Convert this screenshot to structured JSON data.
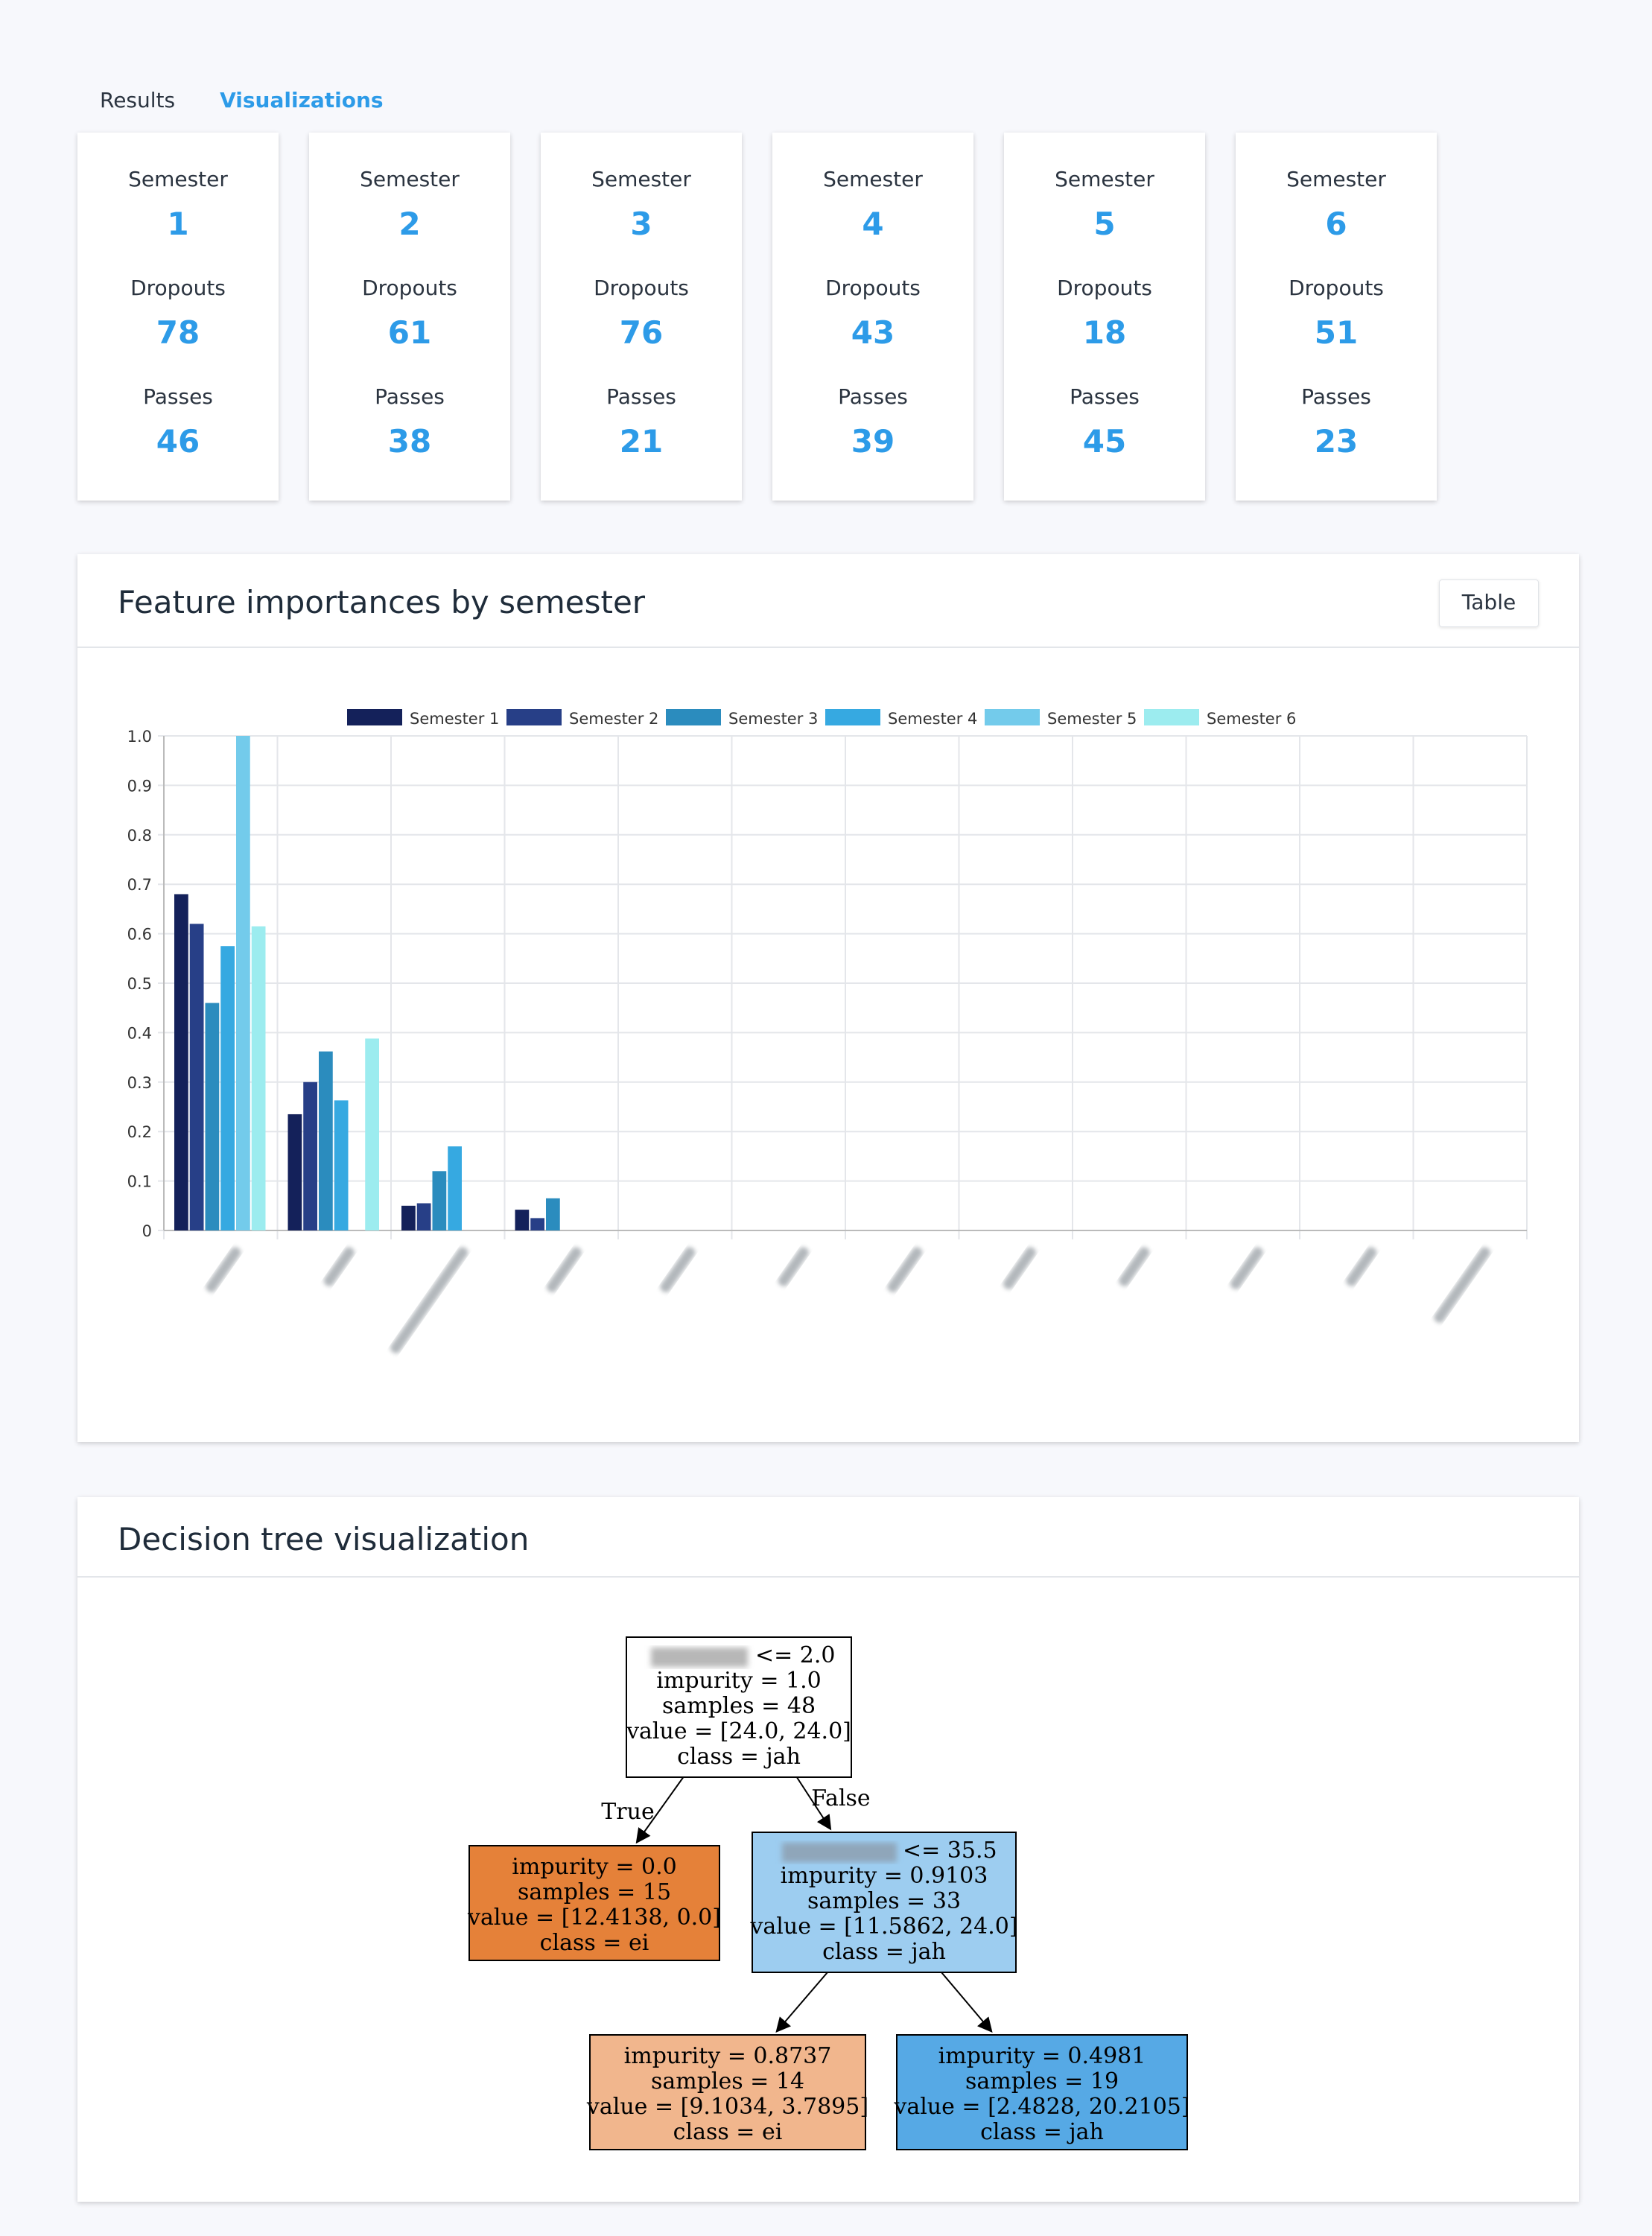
{
  "tabs": [
    {
      "label": "Results",
      "active": false
    },
    {
      "label": "Visualizations",
      "active": true
    }
  ],
  "stat_cards": [
    {
      "semester_label": "Semester",
      "semester": "1",
      "dropouts_label": "Dropouts",
      "dropouts": "78",
      "passes_label": "Passes",
      "passes": "46"
    },
    {
      "semester_label": "Semester",
      "semester": "2",
      "dropouts_label": "Dropouts",
      "dropouts": "61",
      "passes_label": "Passes",
      "passes": "38"
    },
    {
      "semester_label": "Semester",
      "semester": "3",
      "dropouts_label": "Dropouts",
      "dropouts": "76",
      "passes_label": "Passes",
      "passes": "21"
    },
    {
      "semester_label": "Semester",
      "semester": "4",
      "dropouts_label": "Dropouts",
      "dropouts": "43",
      "passes_label": "Passes",
      "passes": "39"
    },
    {
      "semester_label": "Semester",
      "semester": "5",
      "dropouts_label": "Dropouts",
      "dropouts": "18",
      "passes_label": "Passes",
      "passes": "45"
    },
    {
      "semester_label": "Semester",
      "semester": "6",
      "dropouts_label": "Dropouts",
      "dropouts": "51",
      "passes_label": "Passes",
      "passes": "23"
    }
  ],
  "feature_panel": {
    "title": "Feature importances by semester",
    "table_button": "Table"
  },
  "tree_panel": {
    "title": "Decision tree visualization"
  },
  "colors": {
    "accent": "#2d9be8",
    "series": [
      "#14215a",
      "#273f87",
      "#2b8cbe",
      "#36a9e1",
      "#73cbeb",
      "#9cecef"
    ],
    "node_orange": "#e58139",
    "node_light_orange": "#f1b68d",
    "node_light_blue": "#9dcdf0",
    "node_blue": "#56a9e5"
  },
  "chart_data": {
    "type": "bar",
    "title": "",
    "xlabel": "",
    "ylabel": "",
    "ylim": [
      0,
      1.0
    ],
    "yticks": [
      "0",
      "0.1",
      "0.2",
      "0.3",
      "0.4",
      "0.5",
      "0.6",
      "0.7",
      "0.8",
      "0.9",
      "1.0"
    ],
    "grid": true,
    "legend_position": "top-center",
    "categories_blurred": true,
    "categories": [
      "",
      "",
      "",
      "",
      "",
      "",
      "",
      "",
      "",
      "",
      "",
      ""
    ],
    "series": [
      {
        "name": "Semester 1",
        "values": [
          0.68,
          0.235,
          0.05,
          0.042,
          0,
          0,
          0,
          0,
          0,
          0,
          0,
          0
        ]
      },
      {
        "name": "Semester 2",
        "values": [
          0.62,
          0.3,
          0.055,
          0.025,
          0,
          0,
          0,
          0,
          0,
          0,
          0,
          0
        ]
      },
      {
        "name": "Semester 3",
        "values": [
          0.46,
          0.362,
          0.12,
          0.065,
          0,
          0,
          0,
          0,
          0,
          0,
          0,
          0
        ]
      },
      {
        "name": "Semester 4",
        "values": [
          0.575,
          0.263,
          0.17,
          0,
          0,
          0,
          0,
          0,
          0,
          0,
          0,
          0
        ]
      },
      {
        "name": "Semester 5",
        "values": [
          1.0,
          0,
          0,
          0,
          0,
          0,
          0,
          0,
          0,
          0,
          0,
          0
        ]
      },
      {
        "name": "Semester 6",
        "values": [
          0.615,
          0.388,
          0,
          0,
          0,
          0,
          0,
          0,
          0,
          0,
          0,
          0
        ]
      }
    ]
  },
  "tree": {
    "root": {
      "split_op": "<= 2.0",
      "impurity": "impurity = 1.0",
      "samples": "samples = 48",
      "value": "value = [24.0, 24.0]",
      "class": "class = jah"
    },
    "left_edge_label": "True",
    "right_edge_label": "False",
    "left_leaf": {
      "impurity": "impurity = 0.0",
      "samples": "samples = 15",
      "value": "value = [12.4138, 0.0]",
      "class": "class = ei"
    },
    "right_node": {
      "split_op": "<= 35.5",
      "impurity": "impurity = 0.9103",
      "samples": "samples = 33",
      "value": "value = [11.5862, 24.0]",
      "class": "class = jah"
    },
    "right_left_leaf": {
      "impurity": "impurity = 0.8737",
      "samples": "samples = 14",
      "value": "value = [9.1034, 3.7895]",
      "class": "class = ei"
    },
    "right_right_leaf": {
      "impurity": "impurity = 0.4981",
      "samples": "samples = 19",
      "value": "value = [2.4828, 20.2105]",
      "class": "class = jah"
    }
  }
}
